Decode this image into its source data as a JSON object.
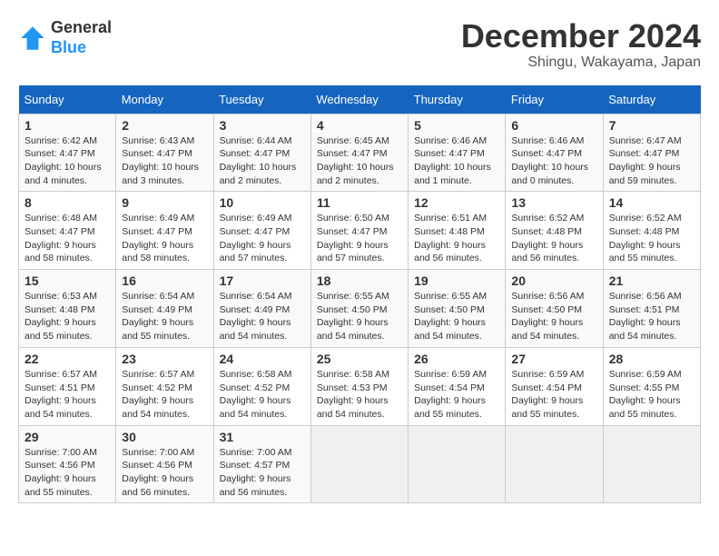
{
  "header": {
    "logo_line1": "General",
    "logo_line2": "Blue",
    "month_title": "December 2024",
    "location": "Shingu, Wakayama, Japan"
  },
  "days_of_week": [
    "Sunday",
    "Monday",
    "Tuesday",
    "Wednesday",
    "Thursday",
    "Friday",
    "Saturday"
  ],
  "weeks": [
    [
      {
        "day": "1",
        "info": "Sunrise: 6:42 AM\nSunset: 4:47 PM\nDaylight: 10 hours\nand 4 minutes."
      },
      {
        "day": "2",
        "info": "Sunrise: 6:43 AM\nSunset: 4:47 PM\nDaylight: 10 hours\nand 3 minutes."
      },
      {
        "day": "3",
        "info": "Sunrise: 6:44 AM\nSunset: 4:47 PM\nDaylight: 10 hours\nand 2 minutes."
      },
      {
        "day": "4",
        "info": "Sunrise: 6:45 AM\nSunset: 4:47 PM\nDaylight: 10 hours\nand 2 minutes."
      },
      {
        "day": "5",
        "info": "Sunrise: 6:46 AM\nSunset: 4:47 PM\nDaylight: 10 hours\nand 1 minute."
      },
      {
        "day": "6",
        "info": "Sunrise: 6:46 AM\nSunset: 4:47 PM\nDaylight: 10 hours\nand 0 minutes."
      },
      {
        "day": "7",
        "info": "Sunrise: 6:47 AM\nSunset: 4:47 PM\nDaylight: 9 hours\nand 59 minutes."
      }
    ],
    [
      {
        "day": "8",
        "info": "Sunrise: 6:48 AM\nSunset: 4:47 PM\nDaylight: 9 hours\nand 58 minutes."
      },
      {
        "day": "9",
        "info": "Sunrise: 6:49 AM\nSunset: 4:47 PM\nDaylight: 9 hours\nand 58 minutes."
      },
      {
        "day": "10",
        "info": "Sunrise: 6:49 AM\nSunset: 4:47 PM\nDaylight: 9 hours\nand 57 minutes."
      },
      {
        "day": "11",
        "info": "Sunrise: 6:50 AM\nSunset: 4:47 PM\nDaylight: 9 hours\nand 57 minutes."
      },
      {
        "day": "12",
        "info": "Sunrise: 6:51 AM\nSunset: 4:48 PM\nDaylight: 9 hours\nand 56 minutes."
      },
      {
        "day": "13",
        "info": "Sunrise: 6:52 AM\nSunset: 4:48 PM\nDaylight: 9 hours\nand 56 minutes."
      },
      {
        "day": "14",
        "info": "Sunrise: 6:52 AM\nSunset: 4:48 PM\nDaylight: 9 hours\nand 55 minutes."
      }
    ],
    [
      {
        "day": "15",
        "info": "Sunrise: 6:53 AM\nSunset: 4:48 PM\nDaylight: 9 hours\nand 55 minutes."
      },
      {
        "day": "16",
        "info": "Sunrise: 6:54 AM\nSunset: 4:49 PM\nDaylight: 9 hours\nand 55 minutes."
      },
      {
        "day": "17",
        "info": "Sunrise: 6:54 AM\nSunset: 4:49 PM\nDaylight: 9 hours\nand 54 minutes."
      },
      {
        "day": "18",
        "info": "Sunrise: 6:55 AM\nSunset: 4:50 PM\nDaylight: 9 hours\nand 54 minutes."
      },
      {
        "day": "19",
        "info": "Sunrise: 6:55 AM\nSunset: 4:50 PM\nDaylight: 9 hours\nand 54 minutes."
      },
      {
        "day": "20",
        "info": "Sunrise: 6:56 AM\nSunset: 4:50 PM\nDaylight: 9 hours\nand 54 minutes."
      },
      {
        "day": "21",
        "info": "Sunrise: 6:56 AM\nSunset: 4:51 PM\nDaylight: 9 hours\nand 54 minutes."
      }
    ],
    [
      {
        "day": "22",
        "info": "Sunrise: 6:57 AM\nSunset: 4:51 PM\nDaylight: 9 hours\nand 54 minutes."
      },
      {
        "day": "23",
        "info": "Sunrise: 6:57 AM\nSunset: 4:52 PM\nDaylight: 9 hours\nand 54 minutes."
      },
      {
        "day": "24",
        "info": "Sunrise: 6:58 AM\nSunset: 4:52 PM\nDaylight: 9 hours\nand 54 minutes."
      },
      {
        "day": "25",
        "info": "Sunrise: 6:58 AM\nSunset: 4:53 PM\nDaylight: 9 hours\nand 54 minutes."
      },
      {
        "day": "26",
        "info": "Sunrise: 6:59 AM\nSunset: 4:54 PM\nDaylight: 9 hours\nand 55 minutes."
      },
      {
        "day": "27",
        "info": "Sunrise: 6:59 AM\nSunset: 4:54 PM\nDaylight: 9 hours\nand 55 minutes."
      },
      {
        "day": "28",
        "info": "Sunrise: 6:59 AM\nSunset: 4:55 PM\nDaylight: 9 hours\nand 55 minutes."
      }
    ],
    [
      {
        "day": "29",
        "info": "Sunrise: 7:00 AM\nSunset: 4:56 PM\nDaylight: 9 hours\nand 55 minutes."
      },
      {
        "day": "30",
        "info": "Sunrise: 7:00 AM\nSunset: 4:56 PM\nDaylight: 9 hours\nand 56 minutes."
      },
      {
        "day": "31",
        "info": "Sunrise: 7:00 AM\nSunset: 4:57 PM\nDaylight: 9 hours\nand 56 minutes."
      },
      {
        "day": "",
        "info": ""
      },
      {
        "day": "",
        "info": ""
      },
      {
        "day": "",
        "info": ""
      },
      {
        "day": "",
        "info": ""
      }
    ]
  ]
}
